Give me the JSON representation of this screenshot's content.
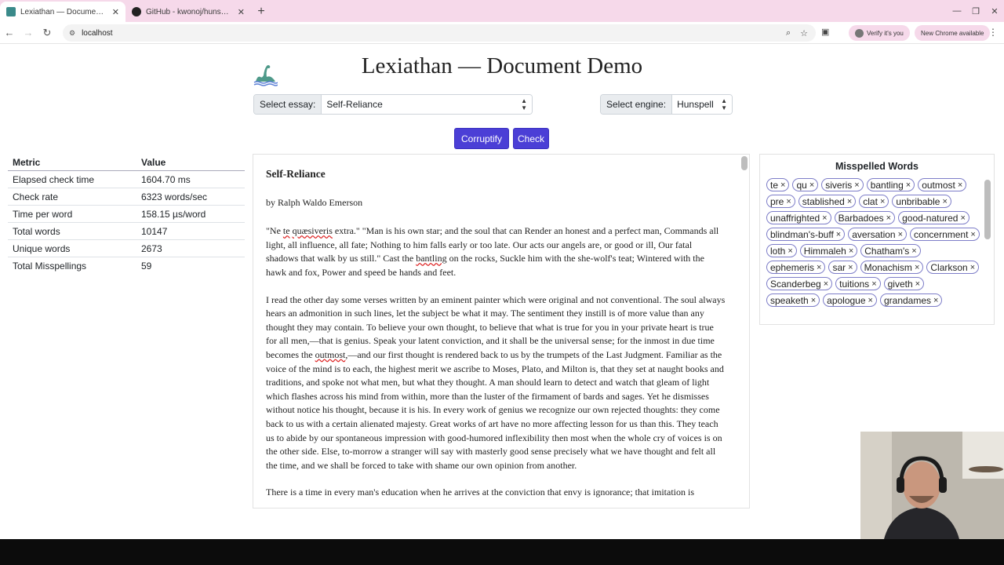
{
  "browser": {
    "tabs": [
      {
        "title": "Lexiathan — Document Demo",
        "active": true
      },
      {
        "title": "GitHub - kwonoj/hunspell-asm",
        "active": false
      }
    ],
    "new_tab": "+",
    "address": "localhost",
    "verify_chip": "Verify it's you",
    "new_chrome_chip": "New Chrome available"
  },
  "page": {
    "title": "Lexiathan — Document Demo",
    "select_essay_label": "Select essay:",
    "select_essay_value": "Self-Reliance",
    "select_engine_label": "Select engine:",
    "select_engine_value": "Hunspell",
    "corruptify_label": "Corruptify",
    "check_label": "Check"
  },
  "metrics": {
    "headers": [
      "Metric",
      "Value"
    ],
    "rows": [
      {
        "metric": "Elapsed check time",
        "value": "1604.70 ms"
      },
      {
        "metric": "Check rate",
        "value": "6323 words/sec"
      },
      {
        "metric": "Time per word",
        "value": "158.15 µs/word"
      },
      {
        "metric": "Total words",
        "value": "10147"
      },
      {
        "metric": "Unique words",
        "value": "2673"
      },
      {
        "metric": "Total Misspellings",
        "value": "59"
      }
    ]
  },
  "document": {
    "heading": "Self-Reliance",
    "author": "by Ralph Waldo Emerson",
    "p1": {
      "a": "\"Ne ",
      "m1": "te",
      "b": " ",
      "m2": "quæsiveris",
      "c": " extra.\" \"Man is his own star; and the soul that can Render an honest and a perfect man, Commands all light, all influence, all fate; Nothing to him falls early or too late. Our acts our angels are, or good or ill, Our fatal shadows that walk by us still.\" Cast the ",
      "m3": "bantling",
      "d": " on the rocks, Suckle him with the she-wolf's teat; Wintered with the hawk and fox, Power and speed be hands and feet."
    },
    "p2": {
      "a": "I read the other day some verses written by an eminent painter which were original and not conventional. The soul always hears an admonition in such lines, let the subject be what it may. The sentiment they instill is of more value than any thought they may contain. To believe your own thought, to believe that what is true for you in your private heart is true for all men,—that is genius. Speak your latent conviction, and it shall be the universal sense; for the inmost in due time becomes the ",
      "m1": "outmost",
      "b": ",—and our first thought is rendered back to us by the trumpets of the Last Judgment. Familiar as the voice of the mind is to each, the highest merit we ascribe to Moses, Plato, and Milton is, that they set at naught books and traditions, and spoke not what men, but what they thought. A man should learn to detect and watch that gleam of light which flashes across his mind from within, more than the luster of the firmament of bards and sages. Yet he dismisses without notice his thought, because it is his. In every work of genius we recognize our own rejected thoughts: they come back to us with a certain alienated majesty. Great works of art have no more affecting lesson for us than this. They teach us to abide by our spontaneous impression with good-humored inflexibility then most when the whole cry of voices is on the other side. Else, to-morrow a stranger will say with masterly good sense precisely what we have thought and felt all the time, and we shall be forced to take with shame our own opinion from another."
    },
    "p3": "There is a time in every man's education when he arrives at the conviction that envy is ignorance; that imitation is"
  },
  "misspelled": {
    "heading": "Misspelled Words",
    "remove_glyph": "×",
    "words": [
      "te",
      "qu",
      "siveris",
      "bantling",
      "outmost",
      "pre",
      "stablished",
      "clat",
      "unbribable",
      "unaffrighted",
      "Barbadoes",
      "good-natured",
      "blindman's-buff",
      "aversation",
      "concernment",
      "loth",
      "Himmaleh",
      "Chatham's",
      "ephemeris",
      "sar",
      "Monachism",
      "Clarkson",
      "Scanderbeg",
      "tuitions",
      "giveth",
      "speaketh",
      "apologue",
      "grandames"
    ]
  },
  "colors": {
    "tabbar": "#f6d9ea",
    "primary_button": "#4b3fd6",
    "tag_border": "#7d7dc8",
    "misspell_underline": "#dd2222"
  }
}
